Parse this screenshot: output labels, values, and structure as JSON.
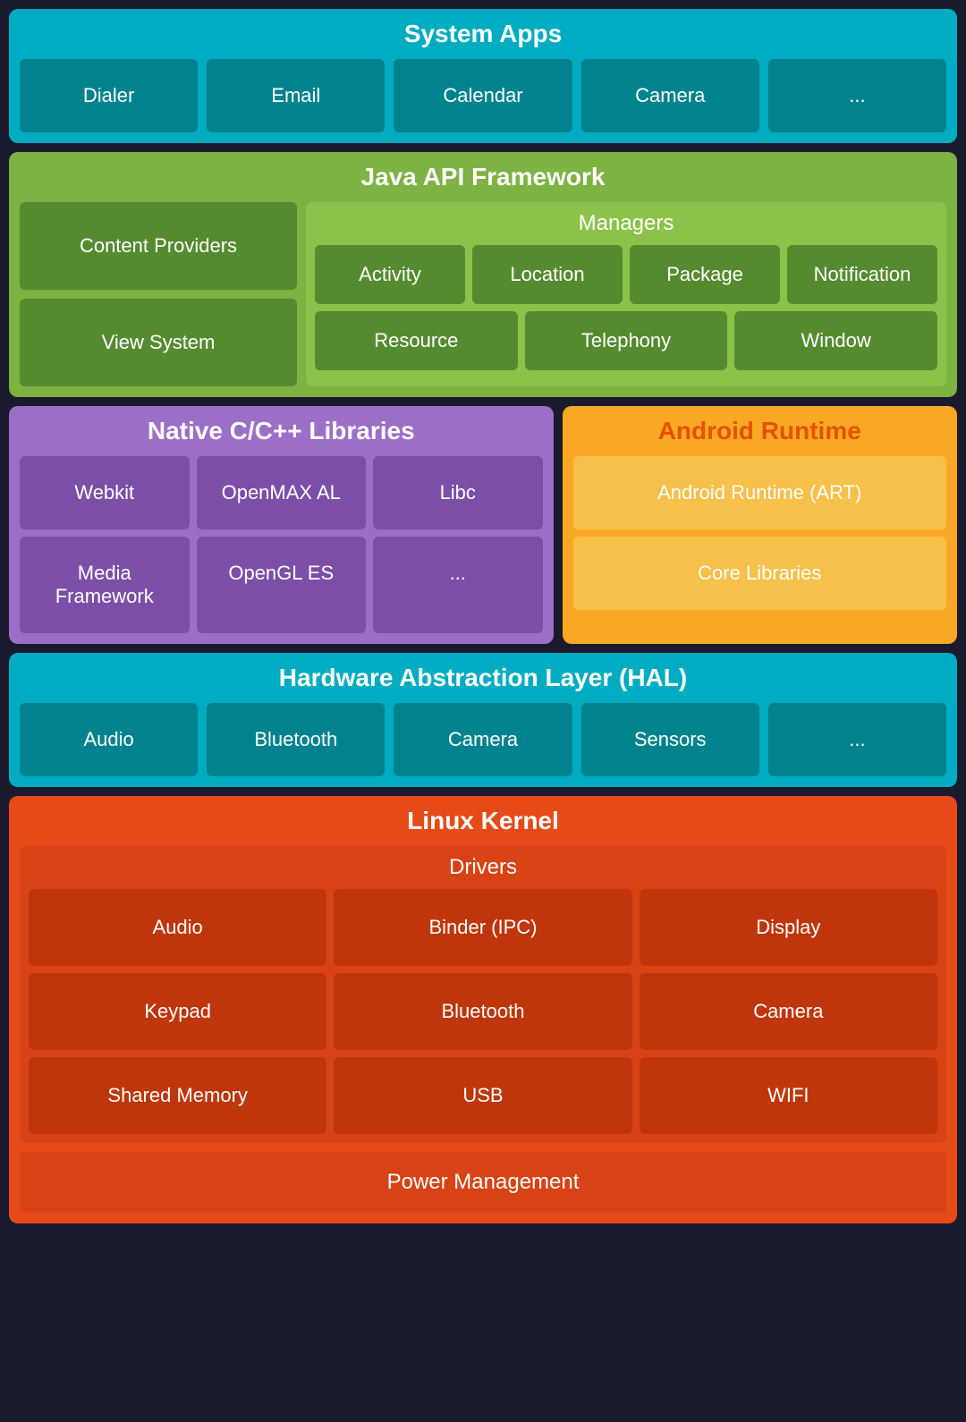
{
  "system_apps": {
    "title": "System Apps",
    "cards": [
      "Dialer",
      "Email",
      "Calendar",
      "Camera",
      "..."
    ]
  },
  "java_api": {
    "title": "Java API Framework",
    "left_cards": [
      "Content Providers",
      "View System"
    ],
    "managers_title": "Managers",
    "managers_row1": [
      "Activity",
      "Location",
      "Package",
      "Notification"
    ],
    "managers_row2": [
      "Resource",
      "Telephony",
      "Window"
    ]
  },
  "native_cpp": {
    "title": "Native C/C++ Libraries",
    "row1": [
      "Webkit",
      "OpenMAX AL",
      "Libc"
    ],
    "row2": [
      "Media Framework",
      "OpenGL ES",
      "..."
    ]
  },
  "android_runtime": {
    "title": "Android Runtime",
    "cards": [
      "Android Runtime (ART)",
      "Core Libraries"
    ]
  },
  "hal": {
    "title": "Hardware Abstraction Layer (HAL)",
    "cards": [
      "Audio",
      "Bluetooth",
      "Camera",
      "Sensors",
      "..."
    ]
  },
  "linux_kernel": {
    "title": "Linux Kernel",
    "drivers_title": "Drivers",
    "drivers_row1": [
      "Audio",
      "Binder (IPC)",
      "Display"
    ],
    "drivers_row2": [
      "Keypad",
      "Bluetooth",
      "Camera"
    ],
    "drivers_row3": [
      "Shared Memory",
      "USB",
      "WIFI"
    ],
    "power_management": "Power Management"
  }
}
